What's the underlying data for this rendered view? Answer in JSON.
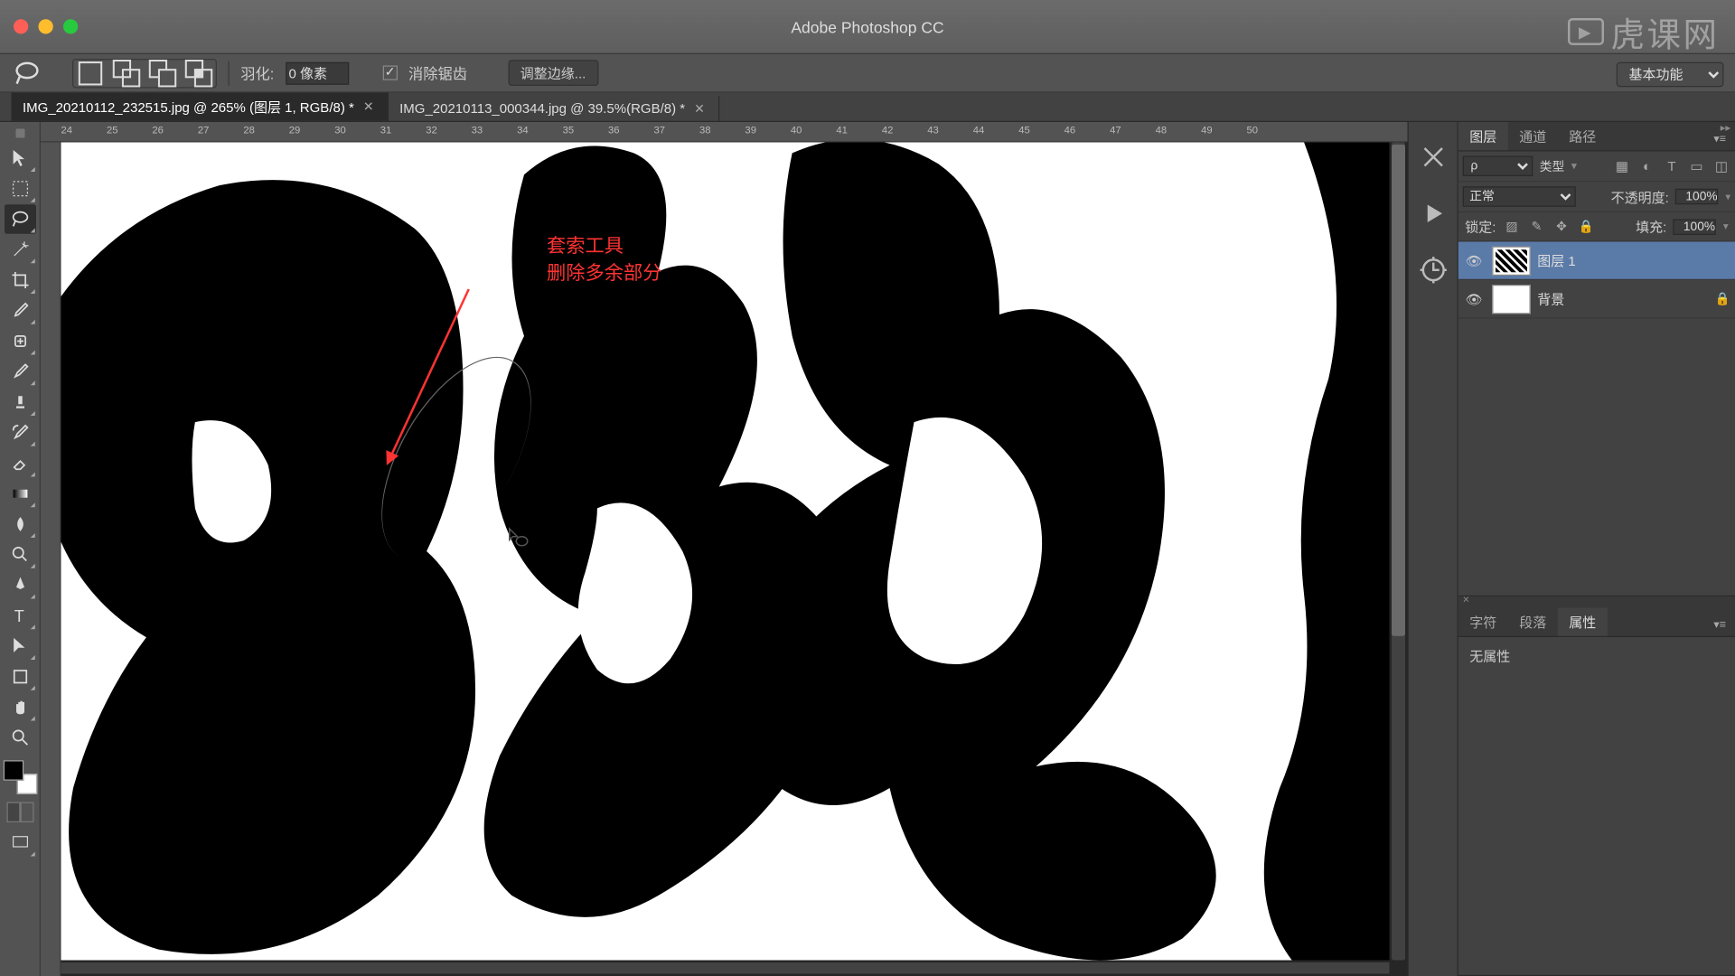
{
  "app": {
    "title": "Adobe Photoshop CC"
  },
  "workspace": {
    "selected": "基本功能"
  },
  "optionsBar": {
    "featherLabel": "羽化:",
    "featherValue": "0 像素",
    "antiAlias": "消除锯齿",
    "refineEdge": "调整边缘..."
  },
  "tabs": [
    {
      "label": "IMG_20210112_232515.jpg @ 265% (图层 1, RGB/8) *",
      "active": true
    },
    {
      "label": "IMG_20210113_000344.jpg @ 39.5%(RGB/8) *",
      "active": false
    }
  ],
  "ruler": {
    "marks": [
      24,
      25,
      26,
      27,
      28,
      29,
      30,
      31,
      32,
      33,
      34,
      35,
      36,
      37,
      38,
      39,
      40,
      41,
      42,
      43,
      44,
      45,
      46,
      47,
      48,
      49,
      50
    ]
  },
  "annotation": {
    "line1": "套索工具",
    "line2": "删除多余部分"
  },
  "panelTabs": {
    "layers": "图层",
    "channels": "通道",
    "paths": "路径",
    "char": "字符",
    "para": "段落",
    "props": "属性"
  },
  "layerPanel": {
    "kindFilter": "类型",
    "blendMode": "正常",
    "opacityLabel": "不透明度:",
    "opacityValue": "100%",
    "lockLabel": "锁定:",
    "fillLabel": "填充:",
    "fillValue": "100%",
    "layers": [
      {
        "name": "图层 1",
        "selected": true
      },
      {
        "name": "背景",
        "locked": true
      }
    ]
  },
  "propsPanel": {
    "noprops": "无属性"
  },
  "watermark": {
    "text": "虎课网"
  }
}
